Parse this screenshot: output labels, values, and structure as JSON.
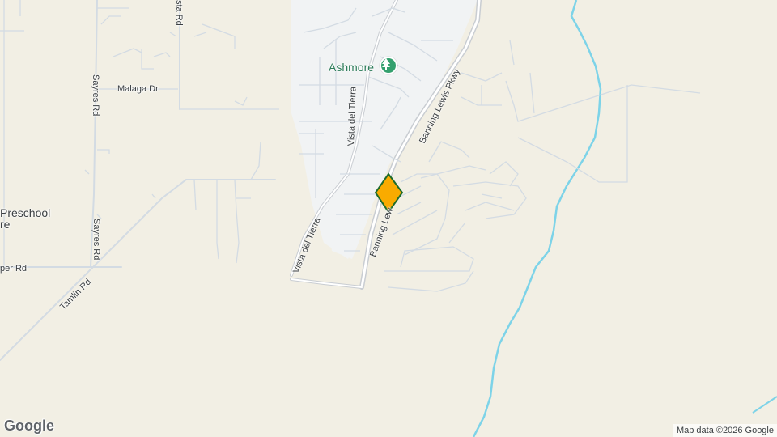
{
  "map": {
    "poi": {
      "name": "Ashmore",
      "icon": "tree-icon",
      "color": "#34a06e"
    },
    "marker": {
      "icon": "diamond-pin-icon",
      "fill": "#f9ab00",
      "stroke": "#1e6b2a"
    },
    "roads": {
      "sayres_1": "Sayres Rd",
      "sayres_2": "Sayres Rd",
      "malaga": "Malaga Dr",
      "top_rd": "sta Rd",
      "vista_1": "Vista del Tierra",
      "vista_2": "Vista del Tierra",
      "banning_1": "Banning Lewis Pkwy",
      "banning_2": "Banning Lew",
      "tamlin": "Tamlin Rd",
      "per_rd": "per Rd"
    },
    "preschool_line1": "Preschool",
    "preschool_line2": "re",
    "logo": "Google",
    "attribution": "Map data ©2026 Google"
  }
}
